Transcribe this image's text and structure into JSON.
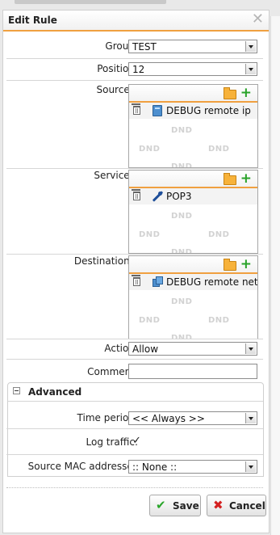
{
  "dialog": {
    "title": "Edit Rule",
    "close_glyph": "✕"
  },
  "form": {
    "group_label": "Group:",
    "group_value": "TEST",
    "position_label": "Position:",
    "position_value": "12",
    "sources_label": "Sources:",
    "services_label": "Services:",
    "destinations_label": "Destinations:",
    "action_label": "Action:",
    "action_value": "Allow",
    "comment_label": "Comment:",
    "comment_value": ""
  },
  "sources": {
    "items": [
      "DEBUG remote ip"
    ],
    "dnd": "DND"
  },
  "services": {
    "items": [
      "POP3"
    ],
    "dnd": "DND"
  },
  "destinations": {
    "items": [
      "DEBUG remote net"
    ],
    "dnd": "DND"
  },
  "advanced": {
    "title": "Advanced",
    "time_period_label": "Time period:",
    "time_period_value": "<< Always >>",
    "log_traffic_label": "Log traffic:",
    "log_traffic_checked": true,
    "log_traffic_glyph": "✓",
    "mac_label": "Source MAC addresses",
    "mac_value": ":: None ::"
  },
  "buttons": {
    "save": "Save",
    "cancel": "Cancel",
    "save_glyph": "✔",
    "cancel_glyph": "✖"
  },
  "icons": {
    "close": "close-icon",
    "folder": "folder-icon",
    "add": "plus-icon",
    "trash": "trash-icon",
    "host": "host-icon",
    "network": "network-icon",
    "service": "service-icon",
    "collapse": "minus-icon"
  },
  "colors": {
    "accent": "#f0a040",
    "add": "#29a329",
    "save": "#2aa52a",
    "cancel": "#d42020",
    "dnd": "#d2d2d2"
  }
}
